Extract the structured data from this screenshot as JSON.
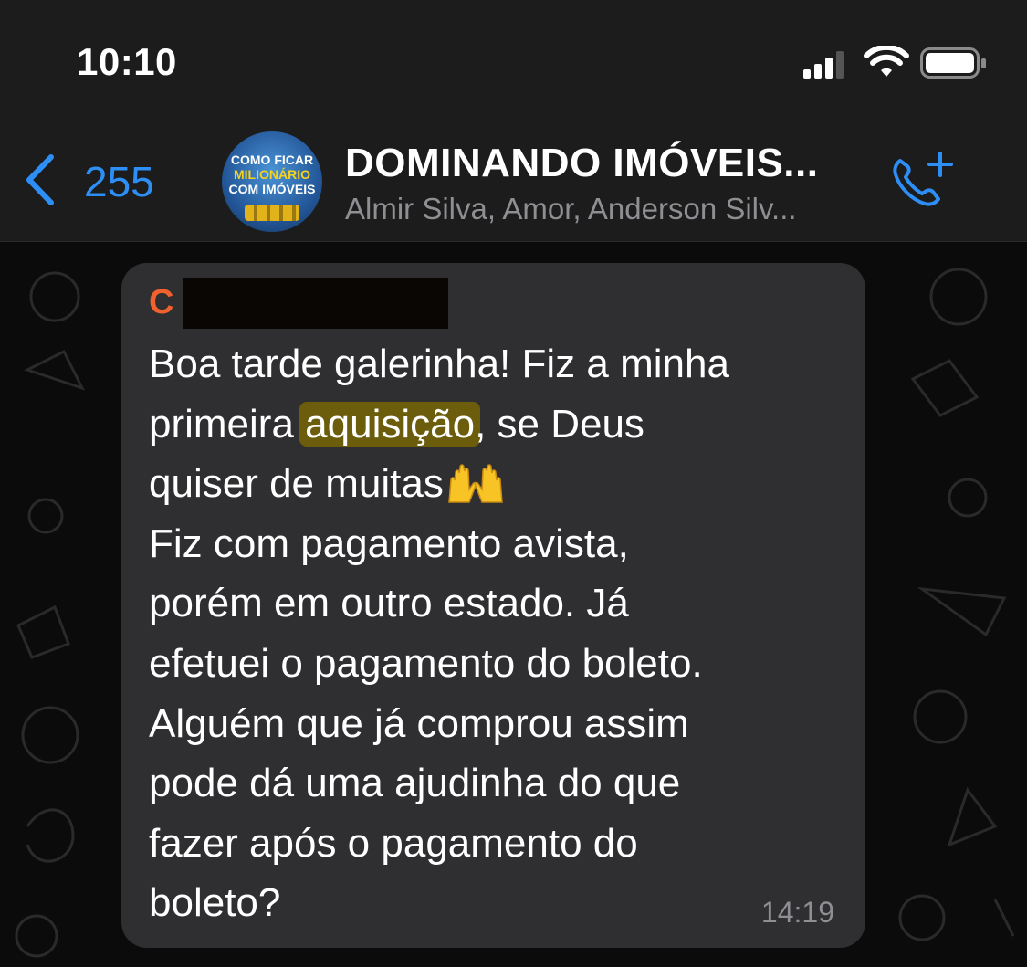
{
  "status_bar": {
    "time": "10:10"
  },
  "header": {
    "back_count": "255",
    "avatar_lines": [
      "COMO FICAR",
      "MILIONÁRIO",
      "COM IMÓVEIS"
    ],
    "title": "DOMINANDO IMÓVEIS...",
    "members": "Almir Silva, Amor, Anderson Silv..."
  },
  "message": {
    "sender_visible": "C",
    "lines": [
      "Boa tarde galerinha! Fiz a minha",
      "primeira",
      "aquisição",
      ", se Deus",
      "quiser de muitas",
      "Fiz com pagamento avista,",
      "porém em outro estado. Já",
      "efetuei o pagamento do boleto.",
      "Alguém que já comprou assim",
      "pode dá uma ajudinha do que",
      "fazer após o pagamento do",
      "boleto?"
    ],
    "timestamp": "14:19"
  },
  "colors": {
    "accent_blue": "#2d8ef5",
    "sender_orange": "#f0612e",
    "bubble": "#2f2f31",
    "highlight": "#6b5d0c"
  },
  "icons": {
    "back": "chevron-left-icon",
    "call": "phone-plus-icon",
    "emoji": "raising-hands-emoji"
  }
}
